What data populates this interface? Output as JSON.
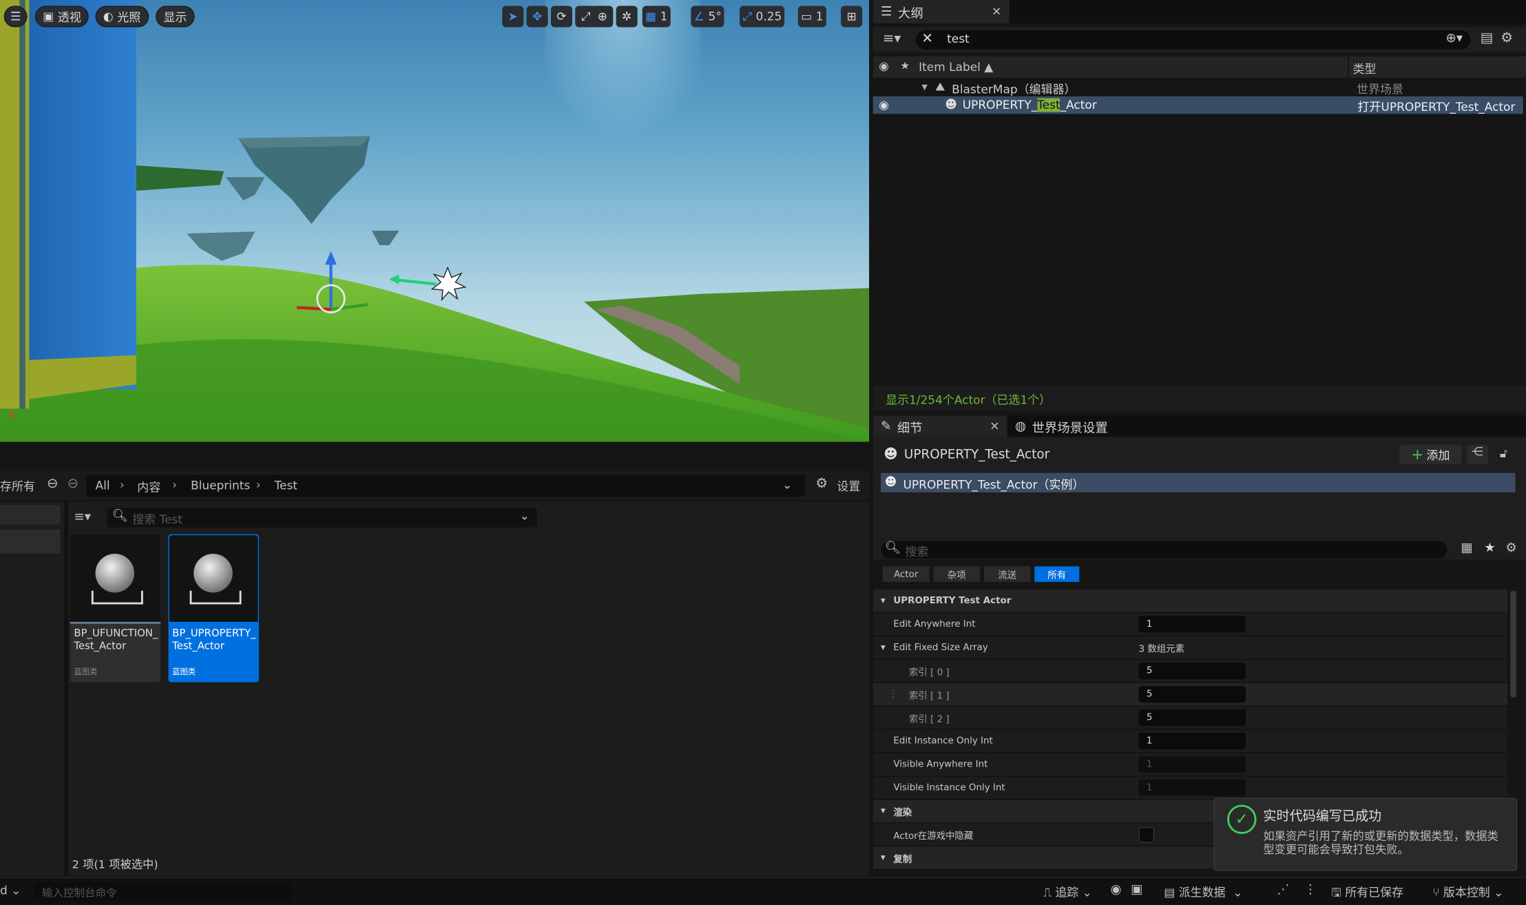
{
  "viewport": {
    "menu_icon": "hamburger-icon",
    "perspective_label": "透视",
    "lighting_label": "光照",
    "show_label": "显示",
    "grid_value": "1",
    "angle_value": "5°",
    "scale_value": "0.25",
    "camera_speed": "1",
    "axis_x": "X",
    "axis_y": "Y"
  },
  "outliner": {
    "tab_title": "大纲",
    "search_value": "test",
    "col_item_label": "Item Label",
    "col_type": "类型",
    "rows": [
      {
        "label": "BlasterMap（编辑器）",
        "type": "世界场景"
      },
      {
        "label_prefix": "UPROPERTY_",
        "label_highlight": "Test",
        "label_suffix": "_Actor",
        "type": "打开UPROPERTY_Test_Actor"
      }
    ],
    "footer": "显示1/254个Actor（已选1个）"
  },
  "details": {
    "tab_title": "细节",
    "tab2_title": "世界场景设置",
    "actor_name": "UPROPERTY_Test_Actor",
    "add_label": "添加",
    "instance_label": "UPROPERTY_Test_Actor（实例）",
    "search_placeholder": "搜索",
    "filters": [
      "Actor",
      "杂项",
      "流送",
      "所有"
    ],
    "section1": "UPROPERTY Test Actor",
    "props": {
      "edit_anywhere": {
        "label": "Edit Anywhere Int",
        "value": "1"
      },
      "fixed_array": {
        "label": "Edit Fixed Size Array",
        "value": "3 数组元素"
      },
      "idx0": {
        "label": "索引 [ 0 ]",
        "value": "5"
      },
      "idx1": {
        "label": "索引 [ 1 ]",
        "value": "5"
      },
      "idx2": {
        "label": "索引 [ 2 ]",
        "value": "5"
      },
      "edit_instance": {
        "label": "Edit Instance Only Int",
        "value": "1"
      },
      "visible_anywhere": {
        "label": "Visible Anywhere Int",
        "value": "1"
      },
      "visible_instance": {
        "label": "Visible Instance Only Int",
        "value": "1"
      }
    },
    "section2": "渲染",
    "hidden_label": "Actor在游戏中隐藏",
    "section3": "复制"
  },
  "content": {
    "left_label": "存所有",
    "crumbs": [
      "All",
      "内容",
      "Blueprints",
      "Test"
    ],
    "settings_label": "设置",
    "search_placeholder": "搜索 Test",
    "assets": [
      {
        "name": "BP_UFUNCTION_\nTest_Actor",
        "type": "蓝图类"
      },
      {
        "name": "BP_UPROPERTY_\nTest_Actor",
        "type": "蓝图类"
      }
    ],
    "count": "2 项(1 项被选中)"
  },
  "toast": {
    "title": "实时代码编写已成功",
    "body": "如果资产引用了新的或更新的数据类型，数据类型变更可能会导致打包失败。"
  },
  "status": {
    "cmd_prefix": "d",
    "console_placeholder": "输入控制台命令",
    "trace_label": "追踪",
    "derived_label": "派生数据",
    "saved_label": "所有已保存",
    "vcs_label": "版本控制"
  },
  "colors": {
    "accent": "#0070e0",
    "highlight": "#7fb23b",
    "success": "#3ecf5a"
  }
}
